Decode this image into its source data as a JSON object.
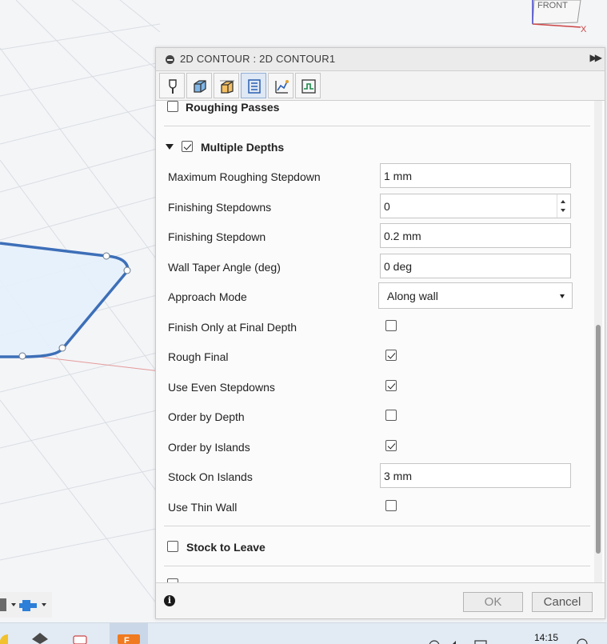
{
  "viewcube": {
    "face_label": "FRONT",
    "axis_label": "X"
  },
  "dialog": {
    "title": "2D CONTOUR : 2D CONTOUR1",
    "tabs": [
      {
        "name": "tool-tab",
        "icon": "tool-bit-icon",
        "active": false
      },
      {
        "name": "geometry-tab",
        "icon": "geometry-icon",
        "active": false
      },
      {
        "name": "heights-tab",
        "icon": "heights-icon",
        "active": false
      },
      {
        "name": "passes-tab",
        "icon": "passes-icon",
        "active": true
      },
      {
        "name": "linking-tab",
        "icon": "linking-icon",
        "active": false
      },
      {
        "name": "post-tab",
        "icon": "post-process-icon",
        "active": false
      }
    ],
    "sections": {
      "roughing_passes": {
        "label": "Roughing Passes",
        "checked": false
      },
      "multiple_depths": {
        "label": "Multiple Depths",
        "checked": true
      },
      "stock_to_leave": {
        "label": "Stock to Leave",
        "checked": false
      }
    },
    "fields": {
      "max_roughing_stepdown": {
        "label": "Maximum Roughing Stepdown",
        "value": "1 mm"
      },
      "finishing_stepdowns": {
        "label": "Finishing Stepdowns",
        "value": "0"
      },
      "finishing_stepdown": {
        "label": "Finishing Stepdown",
        "value": "0.2 mm"
      },
      "wall_taper_angle": {
        "label": "Wall Taper Angle (deg)",
        "value": "0 deg"
      },
      "approach_mode": {
        "label": "Approach Mode",
        "value": "Along wall"
      },
      "stock_on_islands": {
        "label": "Stock On Islands",
        "value": "3 mm"
      }
    },
    "checkboxes": {
      "finish_only_final": {
        "label": "Finish Only at Final Depth",
        "checked": false
      },
      "rough_final": {
        "label": "Rough Final",
        "checked": true
      },
      "use_even_stepdowns": {
        "label": "Use Even Stepdowns",
        "checked": true
      },
      "order_by_depth": {
        "label": "Order by Depth",
        "checked": false
      },
      "order_by_islands": {
        "label": "Order by Islands",
        "checked": true
      },
      "use_thin_wall": {
        "label": "Use Thin Wall",
        "checked": false
      }
    },
    "footer": {
      "ok_label": "OK",
      "cancel_label": "Cancel"
    }
  },
  "taskbar": {
    "clock_time": "14:15"
  },
  "colors": {
    "accent": "#2a5fb0",
    "active_tab": "#dfe8f5",
    "sketch_line": "#3d6fb8"
  }
}
